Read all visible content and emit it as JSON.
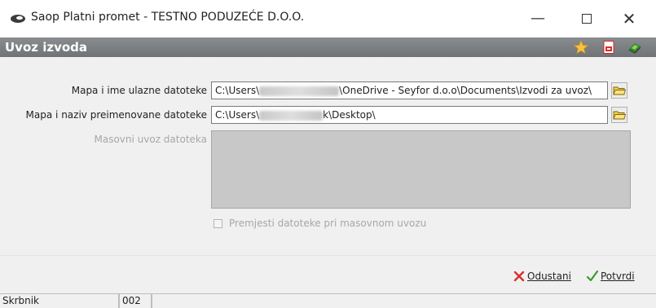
{
  "window": {
    "title": "Saop Platni promet - TESTNO PODUZEĆE D.O.O.",
    "minimize_glyph": "—",
    "close_glyph": "✕"
  },
  "header": {
    "title": "Uvoz izvoda",
    "icons": [
      "star-icon",
      "pdf-icon",
      "help-book-icon"
    ]
  },
  "form": {
    "input_folder_label": "Mapa i ime ulazne datoteke",
    "input_folder_prefix": "C:\\Users\\",
    "input_folder_suffix": "\\OneDrive - Seyfor d.o.o\\Documents\\Izvodi za uvoz\\",
    "rename_folder_label": "Mapa i naziv preimenovane datoteke",
    "rename_folder_prefix": "C:\\Users\\",
    "rename_folder_suffix": "k\\Desktop\\",
    "bulk_import_label": "Masovni uvoz datoteka",
    "bulk_items": [],
    "move_files_label": "Premjesti datoteke pri masovnom uvozu",
    "move_files_checked": false
  },
  "buttons": {
    "cancel_label": "Odustani",
    "confirm_label": "Potvrdi"
  },
  "statusbar": {
    "cell1": "Skrbnik",
    "cell2": "002",
    "cell3": ""
  },
  "colors": {
    "header_bg": "#7a7d7f",
    "cancel_icon": "#d9302c",
    "confirm_icon": "#3a9a2a"
  }
}
